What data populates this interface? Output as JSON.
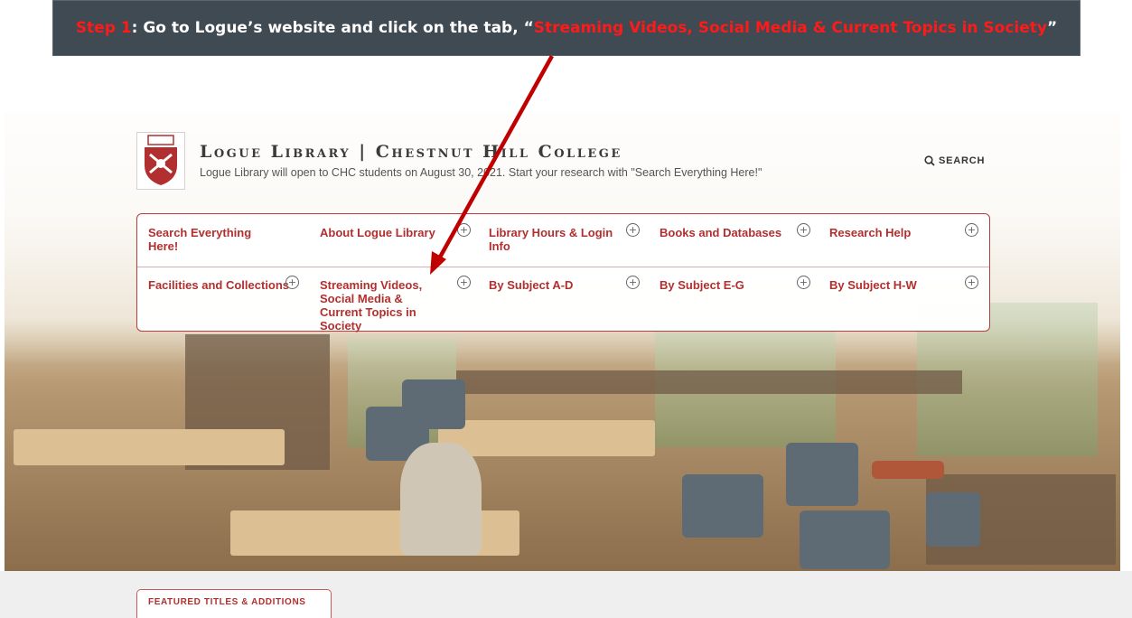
{
  "banner": {
    "step": "Step 1",
    "text_a": ": Go to Logue’s website and click on the tab, “",
    "target": "Streaming Videos, Social Media & Current Topics in Society",
    "text_b": "”"
  },
  "header": {
    "site_title": "Logue Library | Chestnut Hill College",
    "tagline": "Logue Library will open to CHC students on August 30, 2021. Start your research with \"Search Everything Here!\"",
    "search_label": "SEARCH"
  },
  "nav": {
    "row1": [
      {
        "label": "Search Everything Here!",
        "expandable": false
      },
      {
        "label": "About Logue Library",
        "expandable": true
      },
      {
        "label": "Library Hours & Login Info",
        "expandable": true
      },
      {
        "label": "Books and Databases",
        "expandable": true
      },
      {
        "label": "Research Help",
        "expandable": true
      }
    ],
    "row2": [
      {
        "label": "Facilities and Collections",
        "expandable": true
      },
      {
        "label": "Streaming Videos, Social Media & Current Topics in Society",
        "expandable": true
      },
      {
        "label": "By Subject A-D",
        "expandable": true
      },
      {
        "label": "By Subject E-G",
        "expandable": true
      },
      {
        "label": "By Subject H-W",
        "expandable": true
      }
    ],
    "expand_glyph": "+"
  },
  "featured": {
    "tab_label": "FEATURED TITLES & ADDITIONS"
  },
  "colors": {
    "brand_red": "#b22f2f",
    "banner_bg": "#3f4a52",
    "highlight_red": "#ff1a1a"
  }
}
